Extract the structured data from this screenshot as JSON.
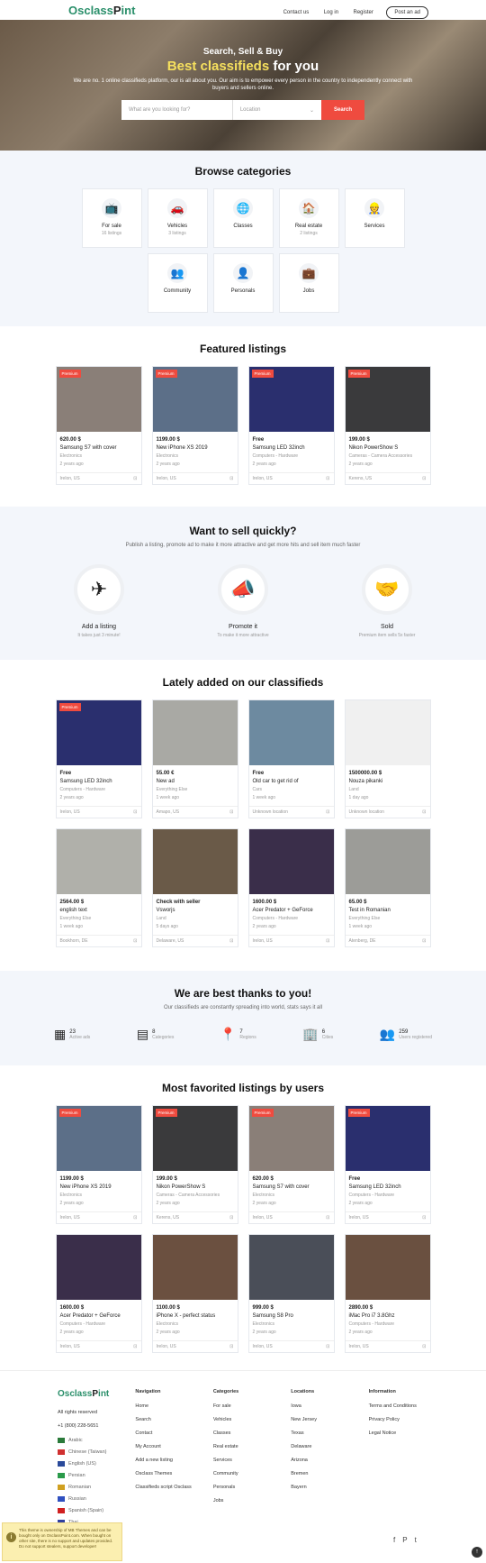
{
  "header": {
    "logo_a": "Osclass",
    "logo_b": "P",
    "logo_c": "int",
    "contact": "Contact us",
    "login": "Log in",
    "register": "Register",
    "post": "Post an ad"
  },
  "hero": {
    "line1": "Search, Sell & Buy",
    "line2a": "Best classifieds",
    "line2b": " for you",
    "lead": "We are no. 1 online classifieds platform, our is all about you. Our aim is to empower every person in the country to independently connect with buyers and sellers online.",
    "search_placeholder": "What are you looking for?",
    "location_placeholder": "Location",
    "search_button": "Search"
  },
  "categories": {
    "title": "Browse categories",
    "items": [
      {
        "label": "For sale",
        "count": "16 listings",
        "icon": "tv-icon"
      },
      {
        "label": "Vehicles",
        "count": "3 listings",
        "icon": "car-icon"
      },
      {
        "label": "Classes",
        "count": "",
        "icon": "globe-icon"
      },
      {
        "label": "Real estate",
        "count": "2 listings",
        "icon": "house-icon"
      },
      {
        "label": "Services",
        "count": "",
        "icon": "worker-icon"
      },
      {
        "label": "Community",
        "count": "",
        "icon": "people-icon"
      },
      {
        "label": "Personals",
        "count": "",
        "icon": "person-icon"
      },
      {
        "label": "Jobs",
        "count": "",
        "icon": "briefcase-icon"
      }
    ]
  },
  "featured": {
    "title": "Featured listings",
    "items": [
      {
        "badge": "Premium",
        "price": "620.00 $",
        "title": "Samsung S7 with cover",
        "cat": "Electronics",
        "age": "2 years ago",
        "loc": "Irelon, US",
        "color": "#8a7f78"
      },
      {
        "badge": "Premium",
        "price": "1199.00 $",
        "title": "New iPhone XS 2019",
        "cat": "Electronics",
        "age": "2 years ago",
        "loc": "Irelon, US",
        "color": "#5c6f88"
      },
      {
        "badge": "Premium",
        "price": "Free",
        "title": "Samsung LED 32inch",
        "cat": "Computers - Hardware",
        "age": "2 years ago",
        "loc": "Irelon, US",
        "color": "#2a2f6e"
      },
      {
        "badge": "Premium",
        "price": "199.00 $",
        "title": "Nikon PowerShow S",
        "cat": "Cameras - Camera Accessories",
        "age": "2 years ago",
        "loc": "Kerens, US",
        "color": "#3a3a3c"
      }
    ]
  },
  "sell": {
    "title": "Want to sell quickly?",
    "sub": "Publish a listing, promote ad to make it more attractive and get more hits and sell item much faster",
    "steps": [
      {
        "t": "Add a listing",
        "s": "It takes just 3 minute!",
        "icon": "paper-plane-icon"
      },
      {
        "t": "Promote it",
        "s": "To make it more attractive",
        "icon": "megaphone-icon"
      },
      {
        "t": "Sold",
        "s": "Premium item sells 5x faster",
        "icon": "handshake-icon"
      }
    ]
  },
  "latest": {
    "title": "Lately added on our classifieds",
    "items": [
      {
        "badge": "Premium",
        "price": "Free",
        "title": "Samsung LED 32inch",
        "cat": "Computers - Hardware",
        "age": "2 years ago",
        "loc": "Irelon, US",
        "color": "#2a2f6e"
      },
      {
        "badge": "",
        "price": "55.00 €",
        "title": "New ad",
        "cat": "Everything Else",
        "age": "1 week ago",
        "loc": "Amapo, US",
        "color": "#a9a9a4"
      },
      {
        "badge": "",
        "price": "Free",
        "title": "Old car to get rid of",
        "cat": "Cars",
        "age": "1 week ago",
        "loc": "Unknown location",
        "color": "#6d8aa0"
      },
      {
        "badge": "",
        "price": "1500000.00 $",
        "title": "Nouza pikanki",
        "cat": "Land",
        "age": "1 day ago",
        "loc": "Unknown location",
        "color": "#f0f0f0"
      },
      {
        "badge": "",
        "price": "2564.00 $",
        "title": "english text",
        "cat": "Everything Else",
        "age": "1 week ago",
        "loc": "Bookhorn, DE",
        "color": "#b0b0aa"
      },
      {
        "badge": "",
        "price": "Check with seller",
        "title": "Vsworjs",
        "cat": "Land",
        "age": "5 days ago",
        "loc": "Delaware, US",
        "color": "#6a5a48"
      },
      {
        "badge": "",
        "price": "1600.00 $",
        "title": "Acer Predator + GeForce",
        "cat": "Computers - Hardware",
        "age": "2 years ago",
        "loc": "Irelon, US",
        "color": "#3a2e4a"
      },
      {
        "badge": "",
        "price": "65.00 $",
        "title": "Test in Romanian",
        "cat": "Everything Else",
        "age": "1 week ago",
        "loc": "Atenberg, DE",
        "color": "#9c9c98"
      }
    ]
  },
  "thanks": {
    "title": "We are best thanks to you!",
    "sub": "Our classifieds are constantly spreading into world, stats says it all",
    "stats": [
      {
        "n": "23",
        "l": "Active ads",
        "icon": "ads-icon"
      },
      {
        "n": "8",
        "l": "Categories",
        "icon": "categories-icon"
      },
      {
        "n": "7",
        "l": "Regions",
        "icon": "map-pin-icon"
      },
      {
        "n": "6",
        "l": "Cities",
        "icon": "city-icon"
      },
      {
        "n": "259",
        "l": "Users registered",
        "icon": "users-icon"
      }
    ]
  },
  "favorites": {
    "title": "Most favorited listings by users",
    "items": [
      {
        "badge": "Premium",
        "price": "1199.00 $",
        "title": "New iPhone XS 2019",
        "cat": "Electronics",
        "age": "2 years ago",
        "loc": "Irelon, US",
        "color": "#5c6f88"
      },
      {
        "badge": "Premium",
        "price": "199.00 $",
        "title": "Nikon PowerShow S",
        "cat": "Cameras - Camera Accessories",
        "age": "2 years ago",
        "loc": "Kerens, US",
        "color": "#3a3a3c"
      },
      {
        "badge": "Premium",
        "price": "620.00 $",
        "title": "Samsung S7 with cover",
        "cat": "Electronics",
        "age": "2 years ago",
        "loc": "Irelon, US",
        "color": "#8a7f78"
      },
      {
        "badge": "Premium",
        "price": "Free",
        "title": "Samsung LED 32inch",
        "cat": "Computers - Hardware",
        "age": "2 years ago",
        "loc": "Irelon, US",
        "color": "#2a2f6e"
      },
      {
        "badge": "",
        "price": "1600.00 $",
        "title": "Acer Predator + GeForce",
        "cat": "Computers - Hardware",
        "age": "2 years ago",
        "loc": "Irelon, US",
        "color": "#3a2e4a"
      },
      {
        "badge": "",
        "price": "1100.00 $",
        "title": "iPhone X - perfect status",
        "cat": "Electronics",
        "age": "2 years ago",
        "loc": "Irelon, US",
        "color": "#6b5040"
      },
      {
        "badge": "",
        "price": "999.00 $",
        "title": "Samsung S8 Pro",
        "cat": "Electronics",
        "age": "2 years ago",
        "loc": "Irelon, US",
        "color": "#4a4e58"
      },
      {
        "badge": "",
        "price": "2890.00 $",
        "title": "iMac Pro i7 3.8Ghz",
        "cat": "Computers - Hardware",
        "age": "2 years ago",
        "loc": "Irelon, US",
        "color": "#6a5040"
      }
    ]
  },
  "footer": {
    "rights": "All rights reserved",
    "phone": "+1 (800) 228-5651",
    "langs": [
      {
        "n": "Arabic",
        "c": "#2a7a3a"
      },
      {
        "n": "Chinese (Taiwan)",
        "c": "#d03030"
      },
      {
        "n": "English (US)",
        "c": "#2a4a9a"
      },
      {
        "n": "Persian",
        "c": "#2a9a4a"
      },
      {
        "n": "Romanian",
        "c": "#d0a020"
      },
      {
        "n": "Russian",
        "c": "#3050c0"
      },
      {
        "n": "Spanish (Spain)",
        "c": "#d02020"
      },
      {
        "n": "Thai",
        "c": "#3040a0"
      }
    ],
    "nav_h": "Navigation",
    "nav": [
      "Home",
      "Search",
      "Contact",
      "My Account",
      "Add a new listing",
      "Osclass Themes",
      "Classifieds script Osclass"
    ],
    "cat_h": "Categories",
    "cats": [
      "For sale",
      "Vehicles",
      "Classes",
      "Real estate",
      "Services",
      "Community",
      "Personals",
      "Jobs"
    ],
    "loc_h": "Locations",
    "locs": [
      "Iowa",
      "New Jersey",
      "Texas",
      "Delaware",
      "Arizona",
      "Bremen",
      "Bayern"
    ],
    "info_h": "Information",
    "info": [
      "Terms and Conditions",
      "Privacy Policy",
      "Legal Notice"
    ]
  },
  "notice": "This theme is ownership of MB Themes and can be bought only on OsclassPoint.com. When bought on other site, there is no support and updates provided. Do not support stealers, support developer!"
}
